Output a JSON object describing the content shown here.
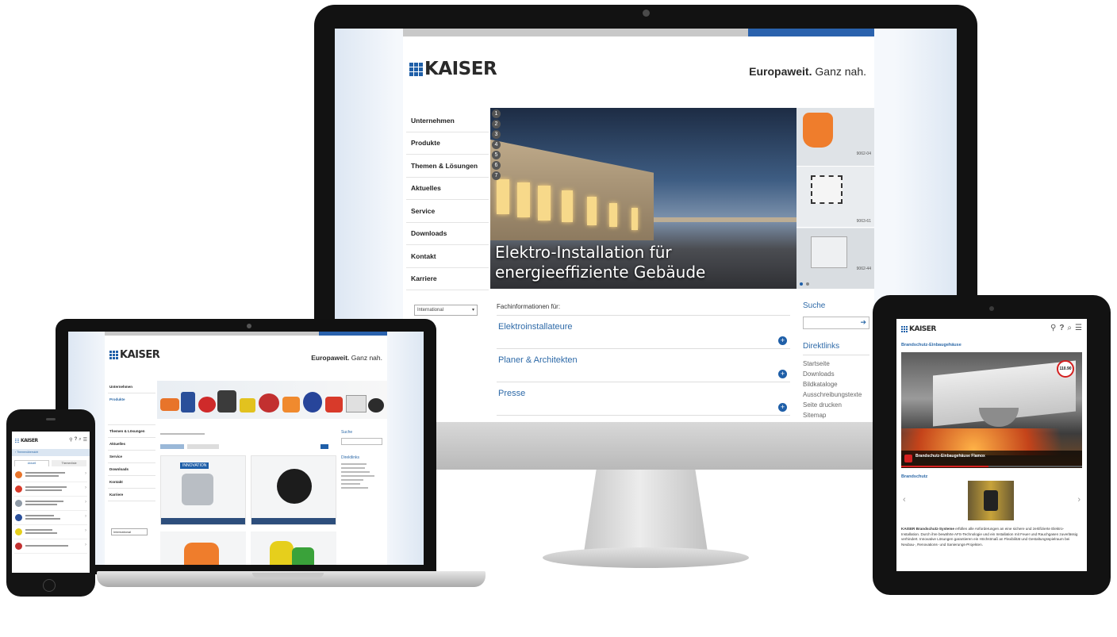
{
  "brand": {
    "name": "KAISER",
    "tagline_bold": "Europaweit.",
    "tagline_rest": " Ganz nah."
  },
  "desktop": {
    "nav": [
      "Unternehmen",
      "Produkte",
      "Themen & Lösungen",
      "Aktuelles",
      "Service",
      "Downloads",
      "Kontakt",
      "Karriere"
    ],
    "hero_title_line1": "Elektro-Installation für",
    "hero_title_line2": "energieeffiziente Gebäude",
    "slide_numbers": [
      "1",
      "2",
      "3",
      "4",
      "5",
      "6",
      "7"
    ],
    "side_codes": [
      "9062-04",
      "9063-61",
      "9062-44"
    ],
    "language_select": "International",
    "info_heading": "Fachinformationen für:",
    "info_items": [
      "Elektroinstallateure",
      "Planer & Architekten",
      "Presse"
    ],
    "search_label": "Suche",
    "direct_heading": "Direktlinks",
    "direct_links": [
      "Startseite",
      "Downloads",
      "Bildkataloge",
      "Ausschreibungstexte",
      "Seite drucken",
      "Sitemap"
    ]
  },
  "laptop": {
    "nav": [
      "Unternehmen",
      "Produkte",
      "Themen & Lösungen",
      "Aktuelles",
      "Service",
      "Downloads",
      "Kontakt",
      "Karriere"
    ],
    "product_badge": "INNOVATION",
    "search_label": "Suche",
    "direct_heading": "Direktlinks",
    "language_select": "International"
  },
  "tablet": {
    "section_title": "Brandschutz-Einbaugehäuse",
    "video_title": "Brandschutz-Einbaugehäuse Flamox",
    "speed_sign": "110.90",
    "sub_heading": "Brandschutz",
    "body_bold": "KAISER Brandschutz-Systeme",
    "body_text": "erfüllen alle Anforderungen an eine sichere und zertifizierte Elektro-Installation. Durch ihre bewährte AFS-Technologie und ein Installation mit Feuer und Rauchgasen zuverlässig verhindert. Innovative Lösungen garantieren ein Höchstmaß an Flexibilität und Gestaltungsspielraum bei Neubau-, Renovations- und Sanierungs-Projekten."
  },
  "phone": {
    "back_label": "Themenübersicht",
    "tab_active": "Aktuell",
    "tab_other": "Themenliste"
  },
  "colors": {
    "accent": "#1f5fa8",
    "link": "#2e6aa8",
    "orange": "#e8742a"
  }
}
